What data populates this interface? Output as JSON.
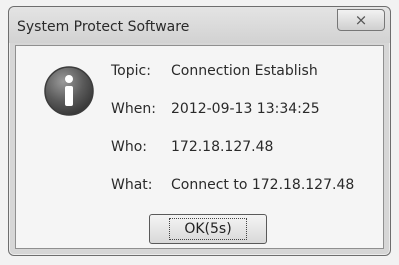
{
  "window": {
    "title": "System Protect Software",
    "close_glyph": "⨯"
  },
  "message": {
    "icon": "info-icon",
    "rows": [
      {
        "label": "Topic:",
        "value": "Connection Establish"
      },
      {
        "label": "When:",
        "value": "2012-09-13 13:34:25"
      },
      {
        "label": "Who:",
        "value": "172.18.127.48"
      },
      {
        "label": "What:",
        "value": "Connect to 172.18.127.48"
      }
    ]
  },
  "buttons": {
    "ok_label": "OK(5s)"
  }
}
